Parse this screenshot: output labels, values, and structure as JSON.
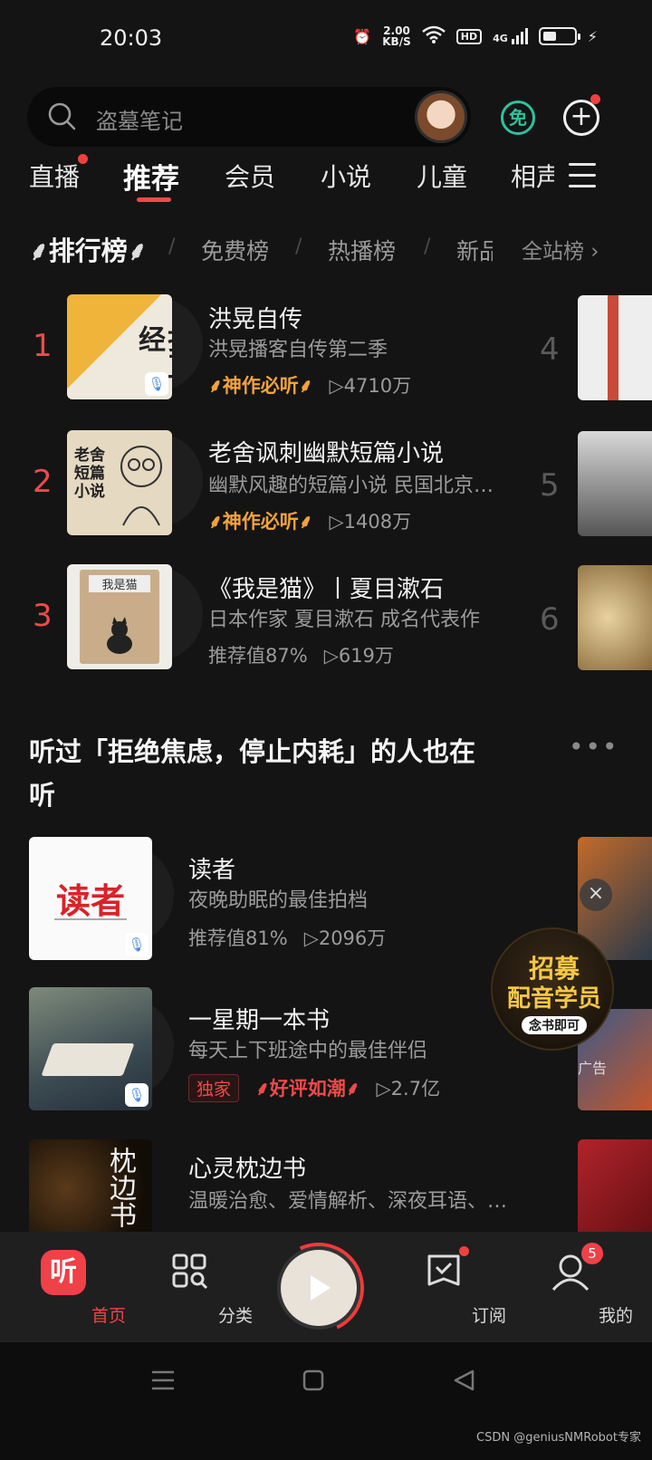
{
  "status_bar": {
    "time": "20:03",
    "speed_value": "2.00",
    "speed_unit": "KB/S",
    "hd": "HD",
    "network": "4G"
  },
  "search": {
    "placeholder": "盗墓笔记",
    "free_label": "免"
  },
  "nav_tabs": [
    "直播",
    "推荐",
    "会员",
    "小说",
    "儿童",
    "相声"
  ],
  "rank_tabs": {
    "main": "排行榜",
    "tabs": [
      "免费榜",
      "热播榜",
      "新品"
    ],
    "all": "全站榜 ›"
  },
  "ranking": [
    {
      "rank": "1",
      "title": "洪晃自传",
      "subtitle": "洪晃播客自传第二季",
      "badge": "神作必听",
      "plays": "▷4710万",
      "cover_text": "打正经"
    },
    {
      "rank": "2",
      "title": "老舍讽刺幽默短篇小说",
      "subtitle": "幽默风趣的短篇小说 民国北京…",
      "badge": "神作必听",
      "plays": "▷1408万",
      "cover_text": "老舍短篇小说"
    },
    {
      "rank": "3",
      "title": "《我是猫》丨夏目漱石",
      "subtitle": "日本作家 夏目漱石 成名代表作",
      "badge": "推荐值87%",
      "plays": "▷619万",
      "cover_text": "我是猫"
    }
  ],
  "ranking_right": [
    "4",
    "5",
    "6"
  ],
  "section": {
    "title": "听过「拒绝焦虑，停止内耗」的人也在听",
    "more": "•••"
  },
  "recommend": [
    {
      "title": "读者",
      "subtitle": "夜晚助眠的最佳拍档",
      "meta1": "推荐值81%",
      "meta2": "▷2096万",
      "cover_text": "读者"
    },
    {
      "title": "一星期一本书",
      "subtitle": "每天上下班途中的最佳伴侣",
      "exclusive": "独家",
      "meta1": "好评如潮",
      "meta2": "▷2.7亿"
    },
    {
      "title": "心灵枕边书",
      "subtitle": "温暖治愈、爱情解析、深夜耳语、…",
      "cover_text": "枕边书"
    }
  ],
  "ad": {
    "line1": "招募",
    "line2": "配音学员",
    "line3": "念书即可",
    "label": "广告",
    "close": "×"
  },
  "bottom_nav": {
    "home": {
      "icon": "听",
      "label": "首页"
    },
    "category": {
      "label": "分类"
    },
    "subscribe": {
      "label": "订阅"
    },
    "mine": {
      "label": "我的",
      "badge": "5"
    }
  },
  "watermark": "CSDN @geniusNMRobot专家",
  "colors": {
    "accent": "#ef4147",
    "gold": "#f3a33a",
    "free_green": "#2fc19e",
    "background": "#141414"
  }
}
